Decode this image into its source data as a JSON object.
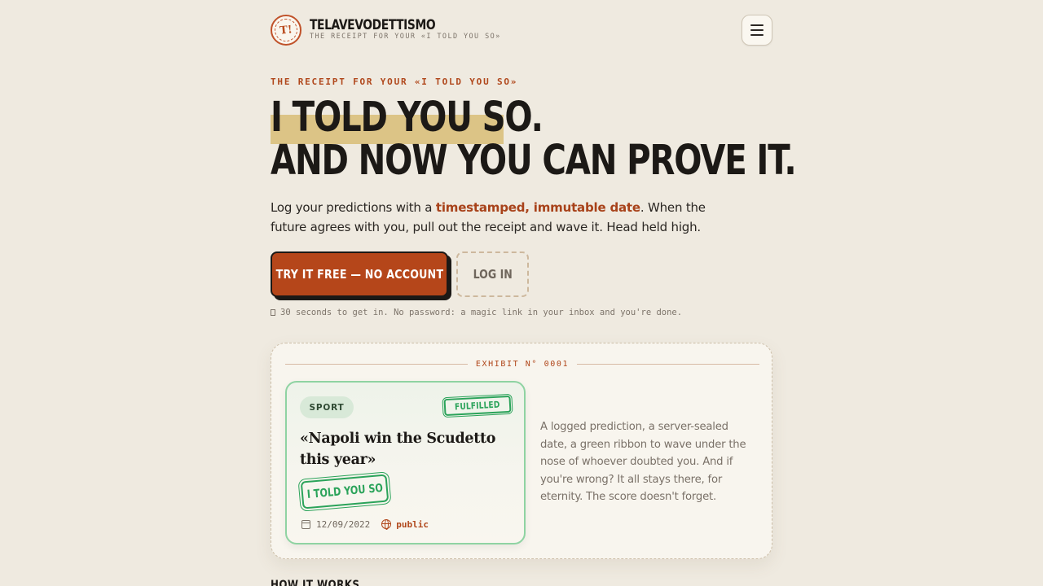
{
  "header": {
    "logo_glyph": "T!",
    "brand_name": "TELAVEVODETTISMO",
    "brand_tagline": "THE RECEIPT FOR YOUR «I TOLD YOU SO»",
    "menu_icon": "hamburger-menu-icon"
  },
  "hero": {
    "eyebrow": "THE RECEIPT FOR YOUR «I TOLD YOU SO»",
    "headline_line1": "I TOLD YOU SO.",
    "headline_line2": "AND NOW YOU CAN PROVE IT.",
    "lead_before": "Log your predictions with a ",
    "lead_emphasis": "timestamped, immutable date",
    "lead_after": ". When the future agrees with you, pull out the receipt and wave it. Head held high.",
    "cta_primary": "TRY IT FREE — NO ACCOUNT",
    "cta_secondary": "LOG IN",
    "note": "30 seconds to get in. No password: a magic link in your inbox and you're done."
  },
  "exhibit": {
    "label": "EXHIBIT N° 0001",
    "card": {
      "category": "SPORT",
      "status_stamp": "FULFILLED",
      "prediction": "«Napoli win the Scudetto this year»",
      "verdict_stamp": "I TOLD YOU SO",
      "date": "12/09/2022",
      "visibility": "public"
    },
    "description": "A logged prediction, a server-sealed date, a green ribbon to wave under the nose of whoever doubted you. And if you're wrong? It all stays there, for eternity. The score doesn't forget."
  },
  "next_section": {
    "title": "HOW IT WORKS"
  },
  "colors": {
    "background": "#efeae0",
    "accent": "#b5461a",
    "highlight": "#dcc486",
    "success": "#2ba35a"
  }
}
